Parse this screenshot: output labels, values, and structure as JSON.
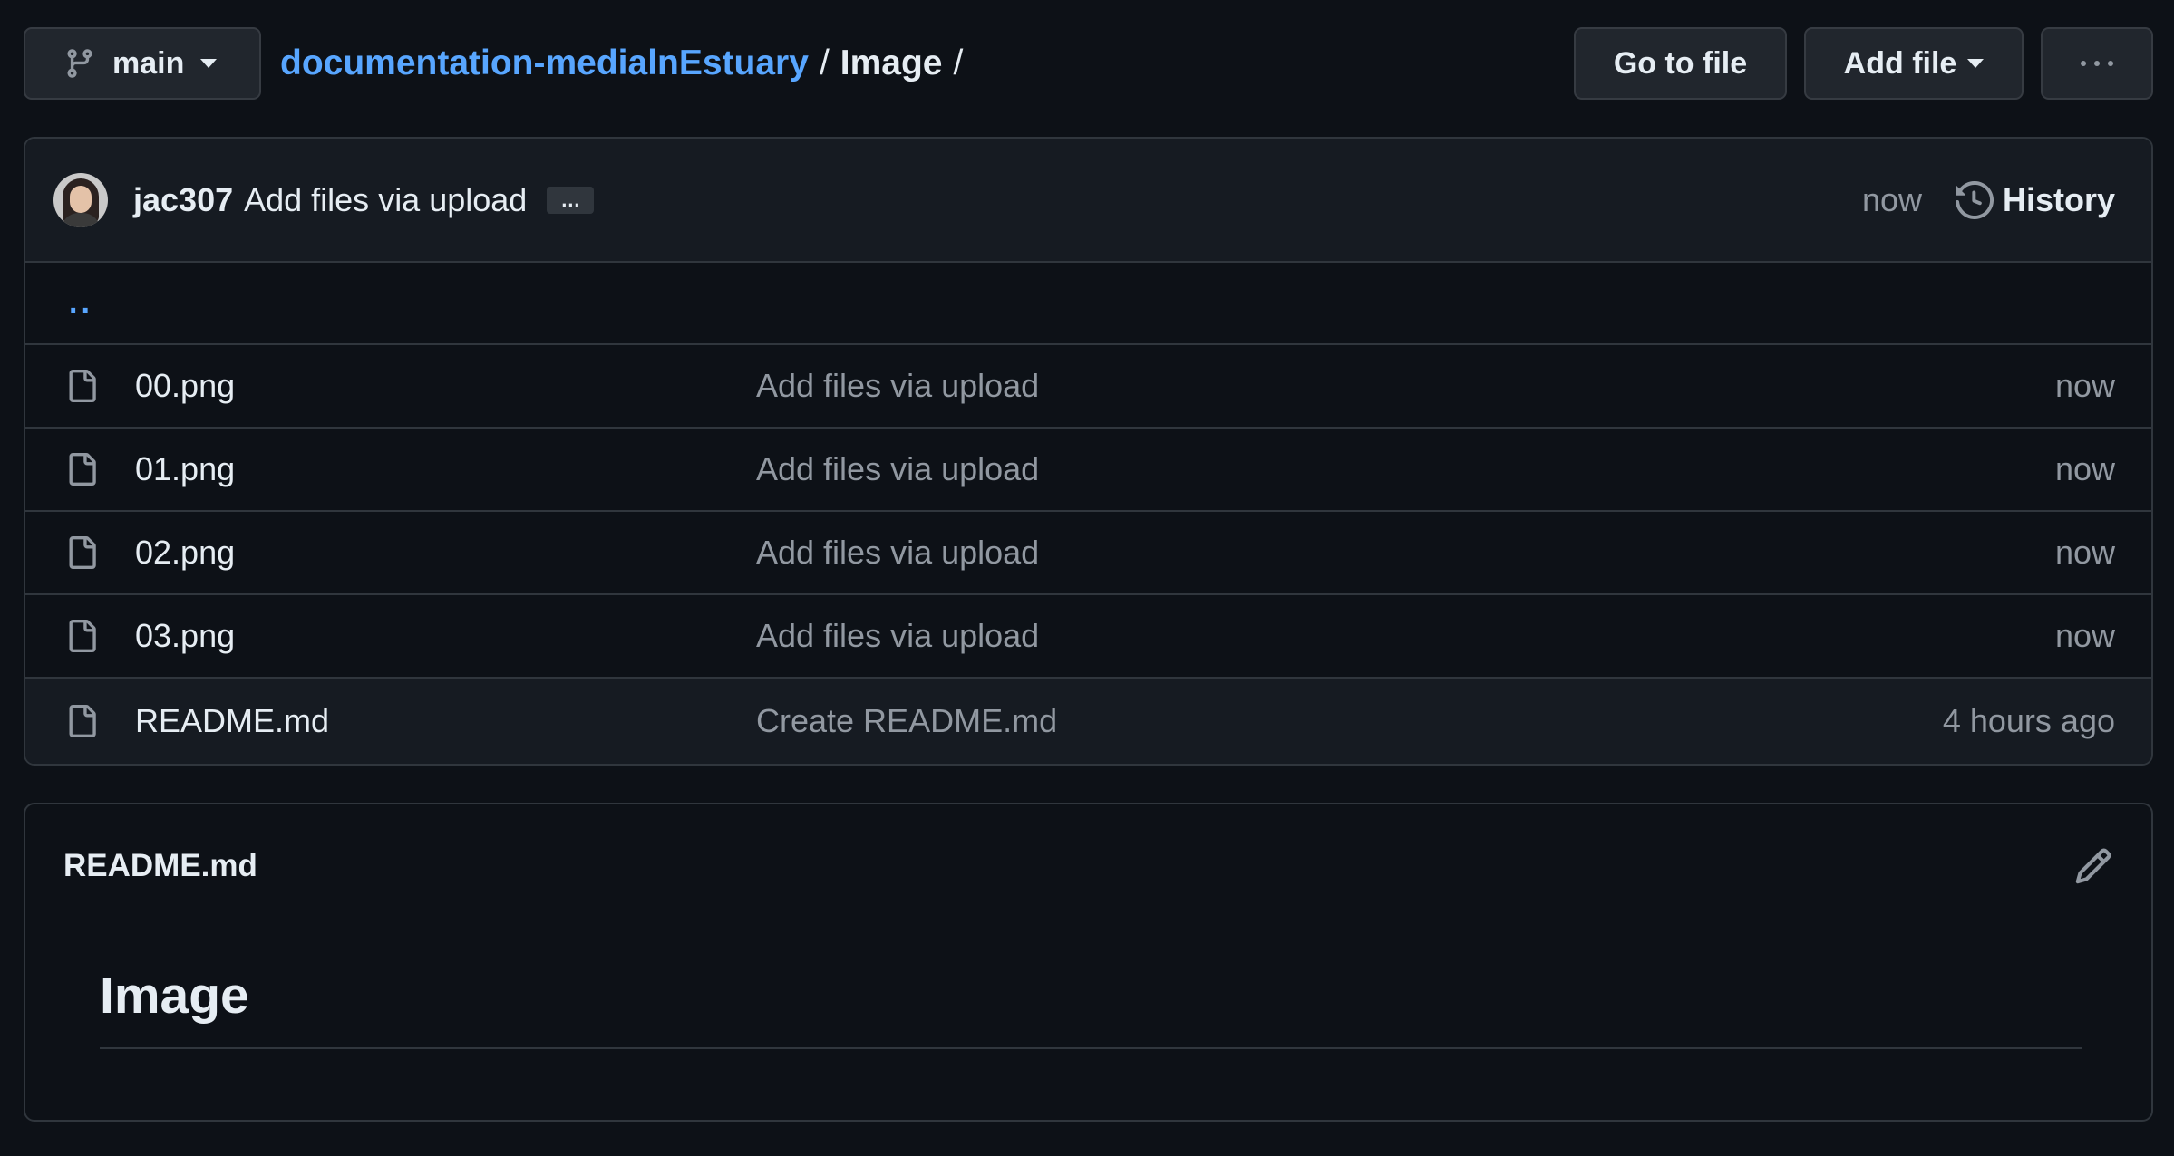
{
  "header": {
    "branch": "main",
    "repo": "documentation-medialnEstuary",
    "sep1": "/",
    "folder": "Image",
    "sep2": "/",
    "go_to_file": "Go to file",
    "add_file": "Add file"
  },
  "latest_commit": {
    "author": "jac307",
    "message": "Add files via upload",
    "ellipsis": "…",
    "time": "now",
    "history_label": "History"
  },
  "parent_dir": "..",
  "files": [
    {
      "name": "00.png",
      "commit": "Add files via upload",
      "time": "now"
    },
    {
      "name": "01.png",
      "commit": "Add files via upload",
      "time": "now"
    },
    {
      "name": "02.png",
      "commit": "Add files via upload",
      "time": "now"
    },
    {
      "name": "03.png",
      "commit": "Add files via upload",
      "time": "now"
    },
    {
      "name": "README.md",
      "commit": "Create README.md",
      "time": "4 hours ago"
    }
  ],
  "readme": {
    "filename": "README.md",
    "heading": "Image"
  },
  "icons": {
    "branch": "git-branch-icon",
    "caret": "caret-down-icon",
    "more": "kebab-horizontal-icon",
    "history": "history-icon",
    "file": "file-icon",
    "edit": "pencil-icon",
    "avatar": "user-avatar"
  },
  "colors": {
    "background": "#0d1117",
    "surface": "#161b22",
    "border": "#30363d",
    "link": "#58a6ff",
    "muted": "#9198a1",
    "text": "#e6edf3"
  }
}
